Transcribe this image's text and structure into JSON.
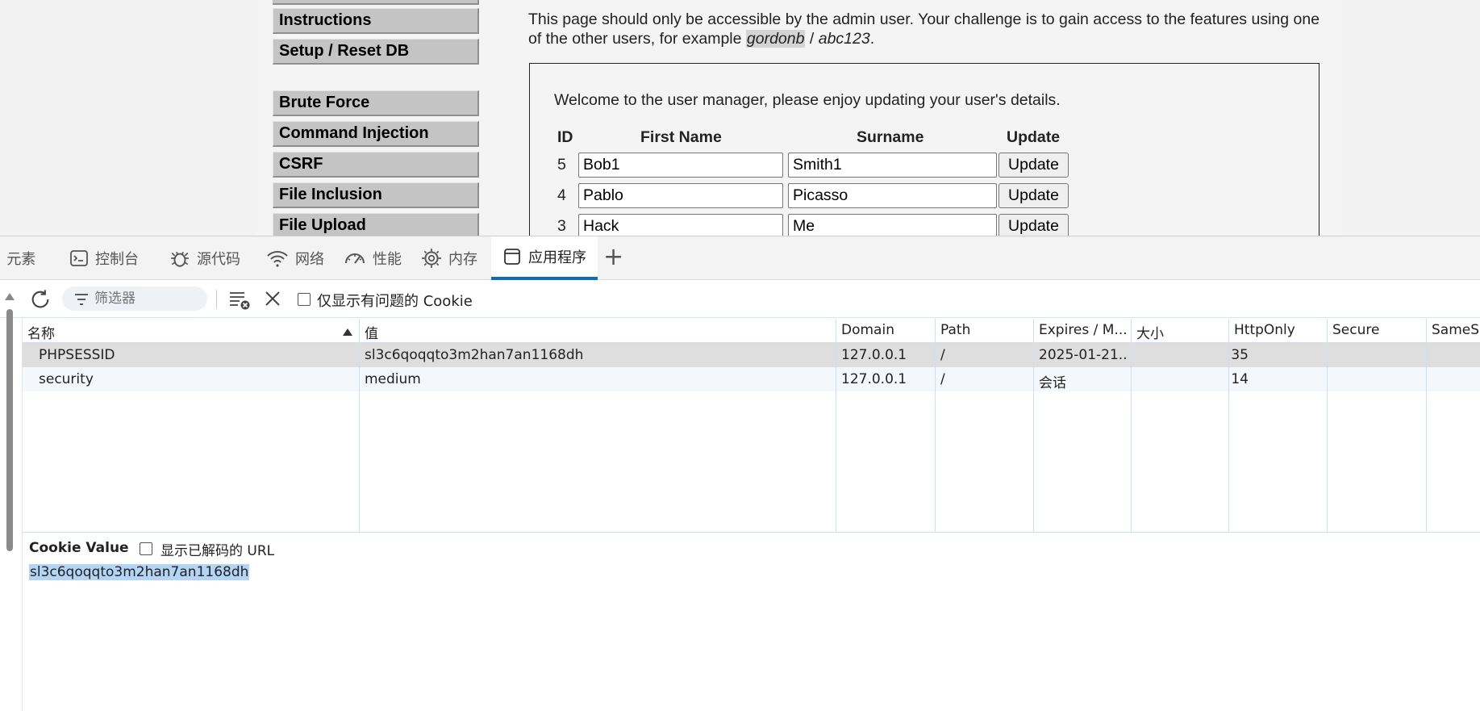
{
  "webpage": {
    "menu": [
      "Instructions",
      "Setup / Reset DB",
      "Brute Force",
      "Command Injection",
      "CSRF",
      "File Inclusion",
      "File Upload"
    ],
    "intro_text_1": "This page should only be accessible by the admin user. Your challenge is to gain access to the features using one of the other users, for example ",
    "intro_user": "gordonb",
    "intro_sep": " / ",
    "intro_pass": "abc123",
    "intro_end": ".",
    "welcome": "Welcome to the user manager, please enjoy updating your user's details.",
    "headers": {
      "id": "ID",
      "first": "First Name",
      "surname": "Surname",
      "update": "Update"
    },
    "users": [
      {
        "id": "5",
        "first": "Bob1",
        "surname": "Smith1",
        "button": "Update"
      },
      {
        "id": "4",
        "first": "Pablo",
        "surname": "Picasso",
        "button": "Update"
      },
      {
        "id": "3",
        "first": "Hack",
        "surname": "Me",
        "button": "Update"
      }
    ]
  },
  "devtools": {
    "tabs": [
      {
        "label": "元素",
        "icon": "elements-icon"
      },
      {
        "label": "控制台",
        "icon": "console-icon"
      },
      {
        "label": "源代码",
        "icon": "bug-icon"
      },
      {
        "label": "网络",
        "icon": "wifi-icon"
      },
      {
        "label": "性能",
        "icon": "gauge-icon"
      },
      {
        "label": "内存",
        "icon": "memory-chip-icon"
      },
      {
        "label": "应用程序",
        "icon": "application-icon",
        "active": true
      }
    ],
    "add_tab": "+",
    "toolbar": {
      "filter_placeholder": "筛选器",
      "only_issues_label": "仅显示有问题的 Cookie"
    },
    "columns": [
      "名称",
      "值",
      "Domain",
      "Path",
      "Expires / M...",
      "大小",
      "HttpOnly",
      "Secure",
      "SameSi"
    ],
    "cookies": [
      {
        "name": "PHPSESSID",
        "value": "sl3c6qoqqto3m2han7an1168dh",
        "domain": "127.0.0.1",
        "path": "/",
        "expires": "2025-01-21...",
        "size": "35",
        "httponly": "",
        "secure": "",
        "samesite": ""
      },
      {
        "name": "security",
        "value": "medium",
        "domain": "127.0.0.1",
        "path": "/",
        "expires": "会话",
        "size": "14",
        "httponly": "",
        "secure": "",
        "samesite": ""
      }
    ],
    "cookie_value": {
      "title": "Cookie Value",
      "decode_label": "显示已解码的 URL",
      "value": "sl3c6qoqqto3m2han7an1168dh"
    },
    "accent_color": "#0f6cbd"
  }
}
